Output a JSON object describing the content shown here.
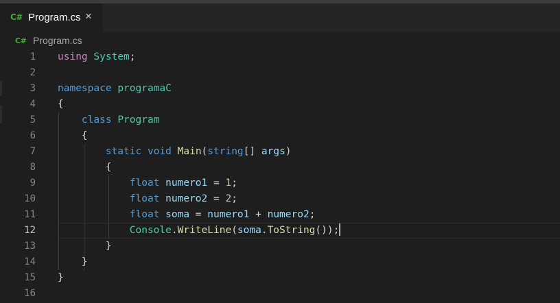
{
  "tab": {
    "icon_text": "C#",
    "label": "Program.cs",
    "close_glyph": "×",
    "icon": "csharp-file-icon"
  },
  "breadcrumb": {
    "icon_text": "C#",
    "label": "Program.cs"
  },
  "editor": {
    "current_line": 12,
    "lines": [
      {
        "number": "1",
        "tokens": [
          {
            "t": "using",
            "c": "kwc"
          },
          {
            "t": " ",
            "c": "pl"
          },
          {
            "t": "System",
            "c": "ty"
          },
          {
            "t": ";",
            "c": "pl"
          }
        ]
      },
      {
        "number": "2",
        "tokens": []
      },
      {
        "number": "3",
        "tokens": [
          {
            "t": "namespace",
            "c": "kw"
          },
          {
            "t": " ",
            "c": "pl"
          },
          {
            "t": "programaC",
            "c": "ty"
          }
        ]
      },
      {
        "number": "4",
        "tokens": [
          {
            "t": "{",
            "c": "pl"
          }
        ]
      },
      {
        "number": "5",
        "tokens": [
          {
            "t": "    ",
            "c": "pl"
          },
          {
            "t": "class",
            "c": "kw"
          },
          {
            "t": " ",
            "c": "pl"
          },
          {
            "t": "Program",
            "c": "ty"
          }
        ]
      },
      {
        "number": "6",
        "tokens": [
          {
            "t": "    {",
            "c": "pl"
          }
        ]
      },
      {
        "number": "7",
        "tokens": [
          {
            "t": "        ",
            "c": "pl"
          },
          {
            "t": "static",
            "c": "kw"
          },
          {
            "t": " ",
            "c": "pl"
          },
          {
            "t": "void",
            "c": "kw"
          },
          {
            "t": " ",
            "c": "pl"
          },
          {
            "t": "Main",
            "c": "fn"
          },
          {
            "t": "(",
            "c": "pl"
          },
          {
            "t": "string",
            "c": "kw"
          },
          {
            "t": "[] ",
            "c": "pl"
          },
          {
            "t": "args",
            "c": "var"
          },
          {
            "t": ")",
            "c": "pl"
          }
        ]
      },
      {
        "number": "8",
        "tokens": [
          {
            "t": "        {",
            "c": "pl"
          }
        ]
      },
      {
        "number": "9",
        "tokens": [
          {
            "t": "            ",
            "c": "pl"
          },
          {
            "t": "float",
            "c": "kw"
          },
          {
            "t": " ",
            "c": "pl"
          },
          {
            "t": "numero1",
            "c": "var"
          },
          {
            "t": " = ",
            "c": "pl"
          },
          {
            "t": "1",
            "c": "num"
          },
          {
            "t": ";",
            "c": "pl"
          }
        ]
      },
      {
        "number": "10",
        "tokens": [
          {
            "t": "            ",
            "c": "pl"
          },
          {
            "t": "float",
            "c": "kw"
          },
          {
            "t": " ",
            "c": "pl"
          },
          {
            "t": "numero2",
            "c": "var"
          },
          {
            "t": " = ",
            "c": "pl"
          },
          {
            "t": "2",
            "c": "num"
          },
          {
            "t": ";",
            "c": "pl"
          }
        ]
      },
      {
        "number": "11",
        "tokens": [
          {
            "t": "            ",
            "c": "pl"
          },
          {
            "t": "float",
            "c": "kw"
          },
          {
            "t": " ",
            "c": "pl"
          },
          {
            "t": "soma",
            "c": "var"
          },
          {
            "t": " = ",
            "c": "pl"
          },
          {
            "t": "numero1",
            "c": "var"
          },
          {
            "t": " + ",
            "c": "pl"
          },
          {
            "t": "numero2",
            "c": "var"
          },
          {
            "t": ";",
            "c": "pl"
          }
        ]
      },
      {
        "number": "12",
        "tokens": [
          {
            "t": "            ",
            "c": "pl"
          },
          {
            "t": "Console",
            "c": "ty"
          },
          {
            "t": ".",
            "c": "pl"
          },
          {
            "t": "WriteLine",
            "c": "fn"
          },
          {
            "t": "(",
            "c": "pl"
          },
          {
            "t": "soma",
            "c": "var"
          },
          {
            "t": ".",
            "c": "pl"
          },
          {
            "t": "ToString",
            "c": "fn"
          },
          {
            "t": "());",
            "c": "pl"
          }
        ]
      },
      {
        "number": "13",
        "tokens": [
          {
            "t": "        }",
            "c": "pl"
          }
        ]
      },
      {
        "number": "14",
        "tokens": [
          {
            "t": "    }",
            "c": "pl"
          }
        ]
      },
      {
        "number": "15",
        "tokens": [
          {
            "t": "}",
            "c": "pl"
          }
        ]
      },
      {
        "number": "16",
        "tokens": []
      }
    ]
  },
  "colors": {
    "background": "#1e1e1e",
    "tabbar": "#252526",
    "keyword": "#569cd6",
    "control_keyword": "#c586c0",
    "type": "#4ec9b0",
    "function": "#dcdcaa",
    "variable": "#9cdcfe",
    "number": "#b5cea8",
    "csharp_icon": "#4aa33f"
  }
}
